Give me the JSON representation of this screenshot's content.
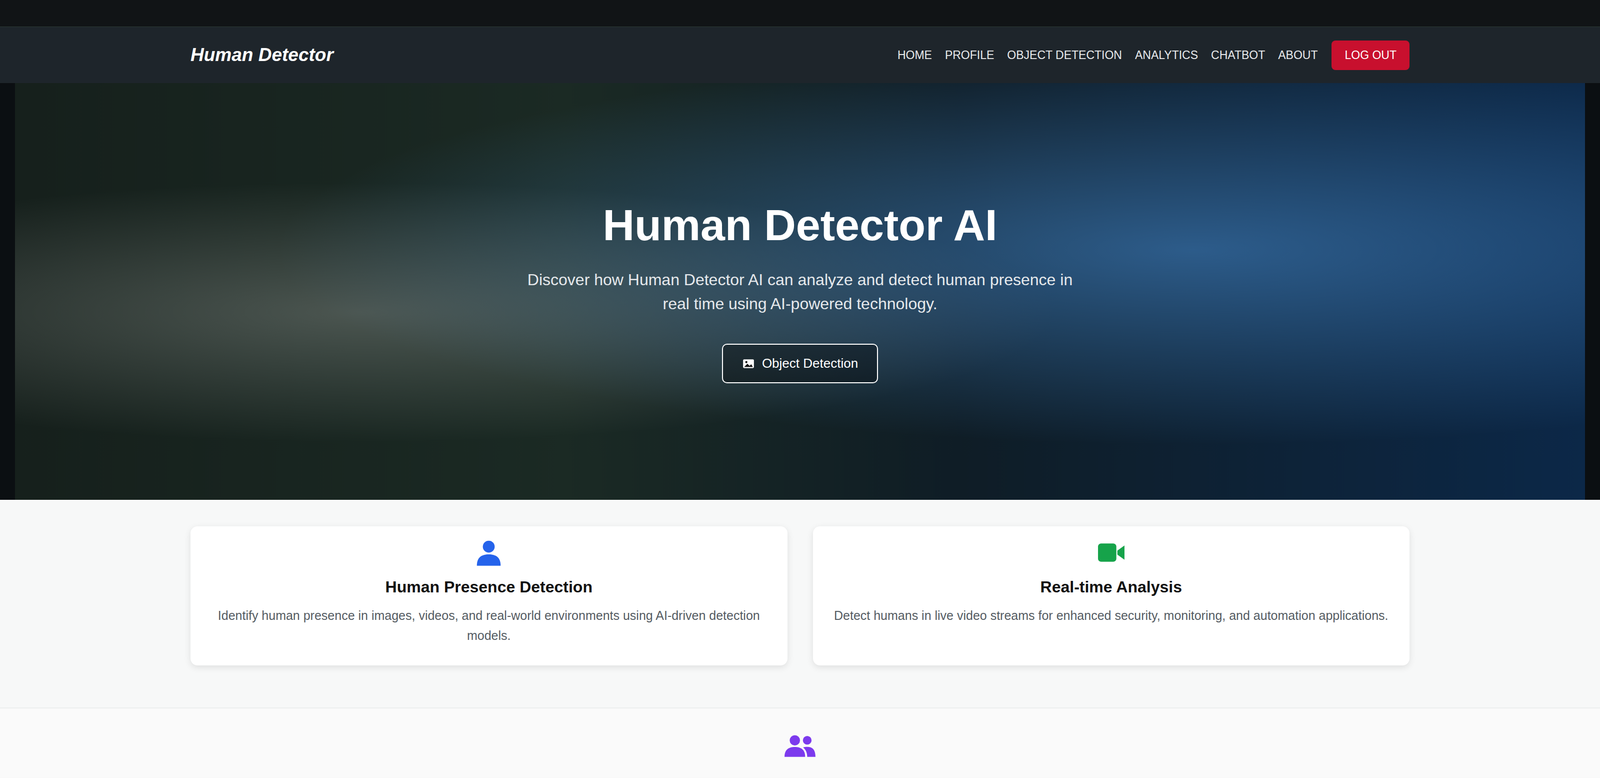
{
  "brand": "Human Detector",
  "nav": {
    "items": [
      {
        "label": "HOME",
        "selected": false
      },
      {
        "label": "PROFILE",
        "selected": false
      },
      {
        "label": "OBJECT DETECTION",
        "selected": false
      },
      {
        "label": "ANALYTICS",
        "selected": false
      },
      {
        "label": "CHATBOT",
        "selected": false
      },
      {
        "label": "ABOUT",
        "selected": false
      }
    ],
    "logout": "LOG OUT"
  },
  "hero": {
    "title": "Human Detector AI",
    "subtitle": "Discover how Human Detector AI can analyze and detect human presence in real time using AI-powered technology.",
    "button": "Object Detection"
  },
  "features": [
    {
      "kind": "user",
      "title": "Human Presence Detection",
      "description": "Identify human presence in images, videos, and real-world environments using AI-driven detection models.",
      "color": "#2563eb"
    },
    {
      "kind": "video",
      "title": "Real-time Analysis",
      "description": "Detect humans in live video streams for enhanced security, monitoring, and automation applications.",
      "color": "#16a34a"
    }
  ]
}
